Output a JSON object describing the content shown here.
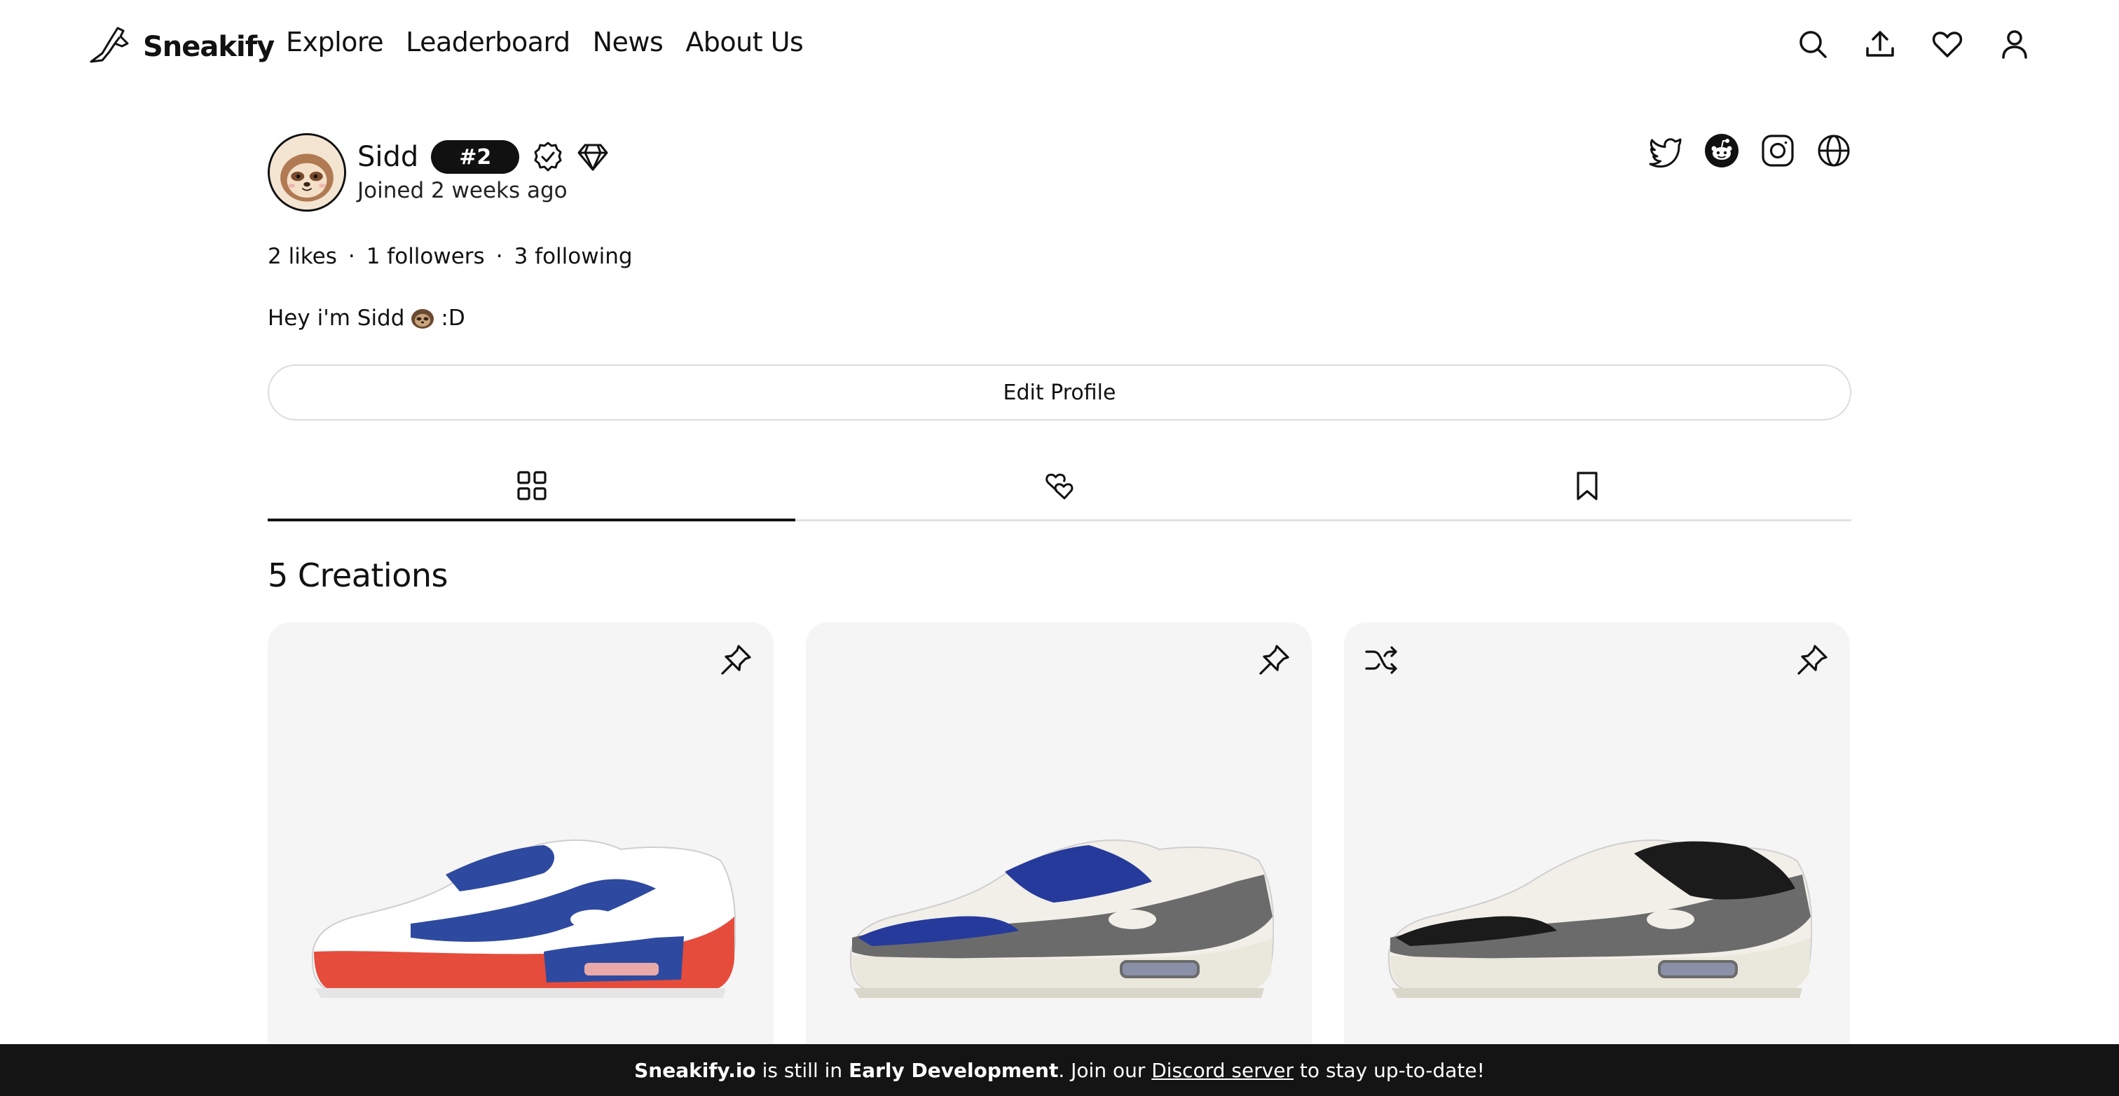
{
  "brand": {
    "name": "Sneakify"
  },
  "nav": {
    "links": [
      "Explore",
      "Leaderboard",
      "News",
      "About Us"
    ],
    "icons": [
      "search-icon",
      "upload-icon",
      "heart-icon",
      "user-icon"
    ]
  },
  "profile": {
    "username": "Sidd",
    "rank": "#2",
    "joined": "Joined 2 weeks ago",
    "stats": {
      "likes": "2 likes",
      "followers": "1 followers",
      "following": "3 following"
    },
    "bio_prefix": "Hey i'm Sidd",
    "bio_suffix": ":D",
    "edit_label": "Edit Profile",
    "socials": [
      "twitter-icon",
      "reddit-icon",
      "instagram-icon",
      "globe-icon"
    ]
  },
  "tabs": [
    "grid-icon",
    "hearts-icon",
    "bookmark-icon"
  ],
  "creations": {
    "title": "5 Creations",
    "items": [
      {
        "colors": {
          "base": "#e64c3c",
          "accent": "#2e4aa0",
          "upper": "#ffffff"
        }
      },
      {
        "colors": {
          "base": "#6b6b6b",
          "accent": "#263a9c",
          "upper": "#f1efe8"
        }
      },
      {
        "colors": {
          "base": "#6b6b6b",
          "accent": "#1b1b1b",
          "upper": "#f1efe8"
        }
      }
    ]
  },
  "banner": {
    "site": "Sneakify.io",
    "text1": " is still in ",
    "stage": "Early Development",
    "text2": ". Join our ",
    "link": "Discord server",
    "text3": " to stay up-to-date!"
  }
}
